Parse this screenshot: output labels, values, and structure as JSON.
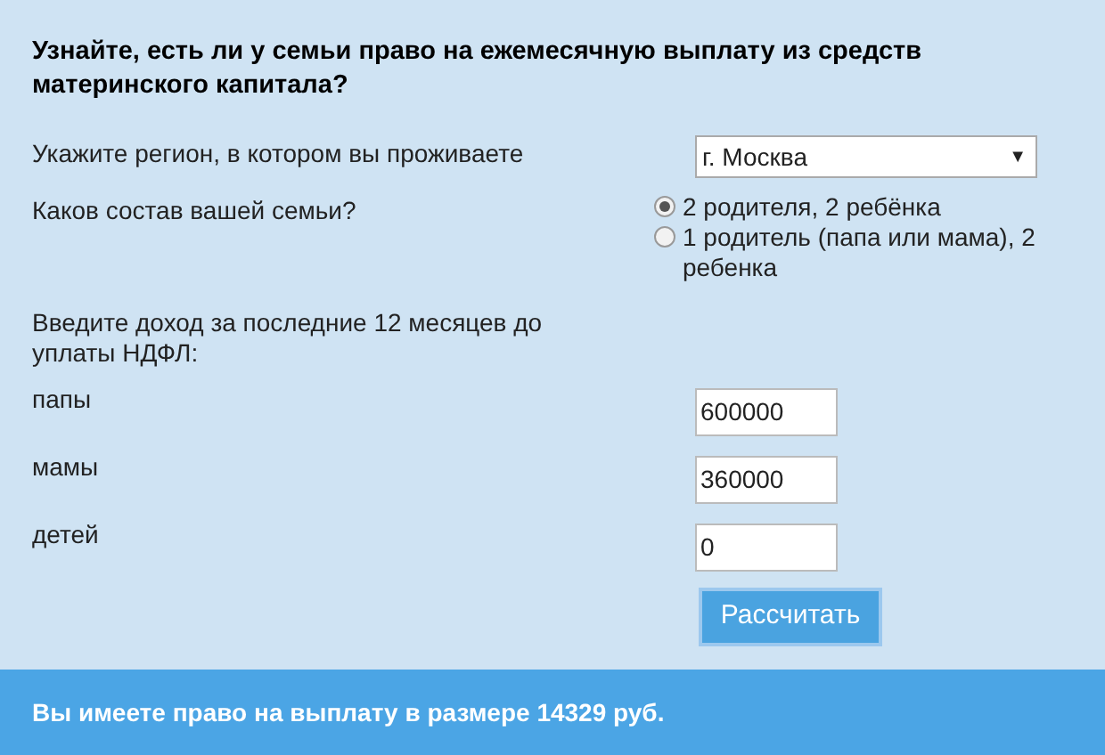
{
  "title": "Узнайте, есть ли у семьи право на ежемесячную выплату из средств материнского капитала?",
  "region": {
    "label": "Укажите регион, в котором вы проживаете",
    "value": "г. Москва",
    "caret": "▼"
  },
  "family": {
    "label": "Каков состав вашей семьи?",
    "options": [
      {
        "label": "2 родителя, 2 ребёнка",
        "selected": true
      },
      {
        "label": "1 родитель (папа или мама), 2 ребенка",
        "selected": false
      }
    ]
  },
  "income": {
    "label": "Введите доход за последние 12 месяцев до уплаты НДФЛ:",
    "fields": [
      {
        "label": "папы",
        "value": "600000"
      },
      {
        "label": "мамы",
        "value": "360000"
      },
      {
        "label": "детей",
        "value": "0"
      }
    ]
  },
  "button": "Рассчитать",
  "result": "Вы имеете право на выплату в размере 14329 руб."
}
